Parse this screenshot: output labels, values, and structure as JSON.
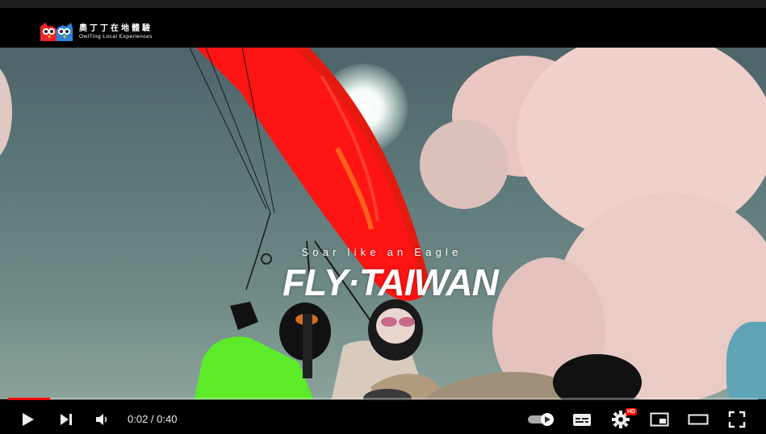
{
  "video": {
    "channel_logo_cn": "奧丁丁在地體驗",
    "channel_logo_en": "OwlTing Local Experiences",
    "overlay_tagline": "Soar like an Eagle",
    "overlay_title": "FLY·TAIWAN"
  },
  "player": {
    "current_time": "0:02",
    "separator": " / ",
    "duration": "0:40",
    "progress_fraction": 0.056,
    "quality_badge": "HD",
    "accent_color": "#ff0000",
    "icons": [
      "play-icon",
      "next-icon",
      "volume-icon",
      "autoplay-toggle-icon",
      "subtitles-icon",
      "settings-icon",
      "miniplayer-icon",
      "theater-icon",
      "fullscreen-icon"
    ]
  }
}
